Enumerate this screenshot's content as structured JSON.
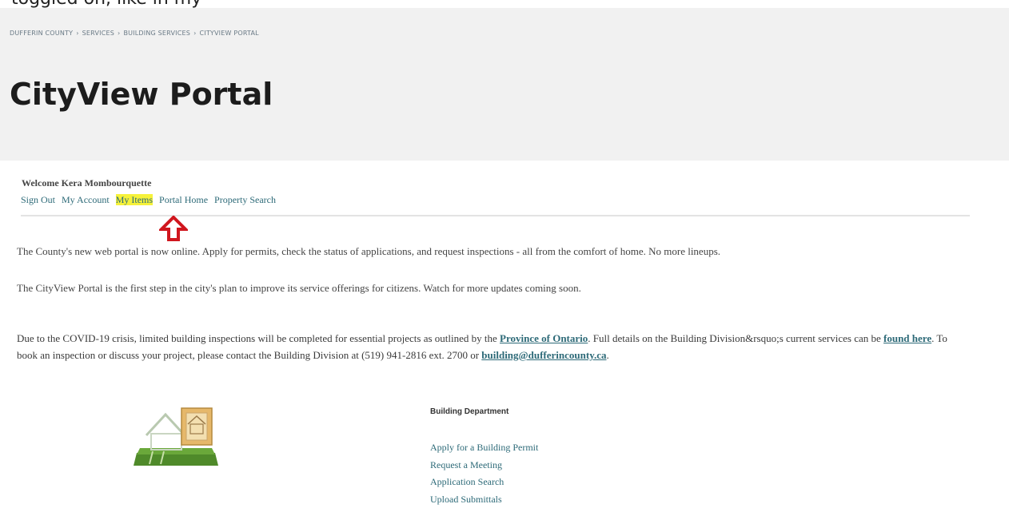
{
  "top_cut_text": "toggled on, like in my",
  "breadcrumb": {
    "items": [
      "DUFFERIN COUNTY",
      "SERVICES",
      "BUILDING SERVICES",
      "CITYVIEW PORTAL"
    ],
    "separator": "›"
  },
  "page_title": "CityView Portal",
  "welcome_text": "Welcome Kera Mombourquette",
  "user_links": {
    "sign_out": "Sign Out",
    "my_account": "My Account",
    "my_items": "My Items",
    "portal_home": "Portal Home",
    "property_search": "Property Search"
  },
  "intro_paragraphs": [
    "The County's new web portal is now online. Apply for permits, check the status of applications, and request inspections - all from the comfort of home. No more lineups.",
    "The CityView Portal is the first step in the city's plan to improve its service offerings for citizens. Watch for more updates coming soon."
  ],
  "covid_notice": {
    "part1": "Due to the COVID-19 crisis, limited building inspections will be completed for essential projects as outlined by the ",
    "link1": "Province of Ontario",
    "part2": ". Full details on the Building Division&rsquo;s current services can be ",
    "link2": "found here",
    "part3": ". To book an inspection or discuss your project, please contact the Building Division at (519) 941-2816 ext. 2700 or ",
    "link3": "building@dufferincounty.ca",
    "part4": "."
  },
  "building_department": {
    "title": "Building Department",
    "links": [
      "Apply for a Building Permit",
      "Request a Meeting",
      "Application Search",
      "Upload Submittals"
    ]
  },
  "colors": {
    "link": "#2d6a78",
    "highlight": "#f6f23a",
    "arrow": "#d0161e",
    "header_band": "#f1f1f1"
  },
  "icons": {
    "annotation_arrow": "arrow-up-icon",
    "house": "house-document-icon"
  }
}
